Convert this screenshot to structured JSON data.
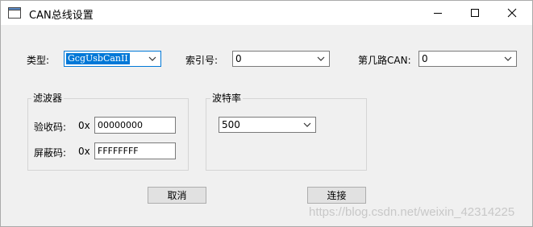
{
  "window": {
    "title": "CAN总线设置"
  },
  "fields": {
    "type": {
      "label": "类型:",
      "value": "GcgUsbCanII"
    },
    "index": {
      "label": "索引号:",
      "value": "0"
    },
    "channel": {
      "label": "第几路CAN:",
      "value": "0"
    }
  },
  "filter": {
    "title": "滤波器",
    "acc_code": {
      "label": "验收码:",
      "prefix": "0x",
      "value": "00000000"
    },
    "mask_code": {
      "label": "屏蔽码:",
      "prefix": "0x",
      "value": "FFFFFFFF"
    }
  },
  "baud": {
    "title": "波特率",
    "value": "500"
  },
  "buttons": {
    "cancel": "取消",
    "connect": "连接"
  },
  "watermark": "https://blog.csdn.net/weixin_42314225"
}
